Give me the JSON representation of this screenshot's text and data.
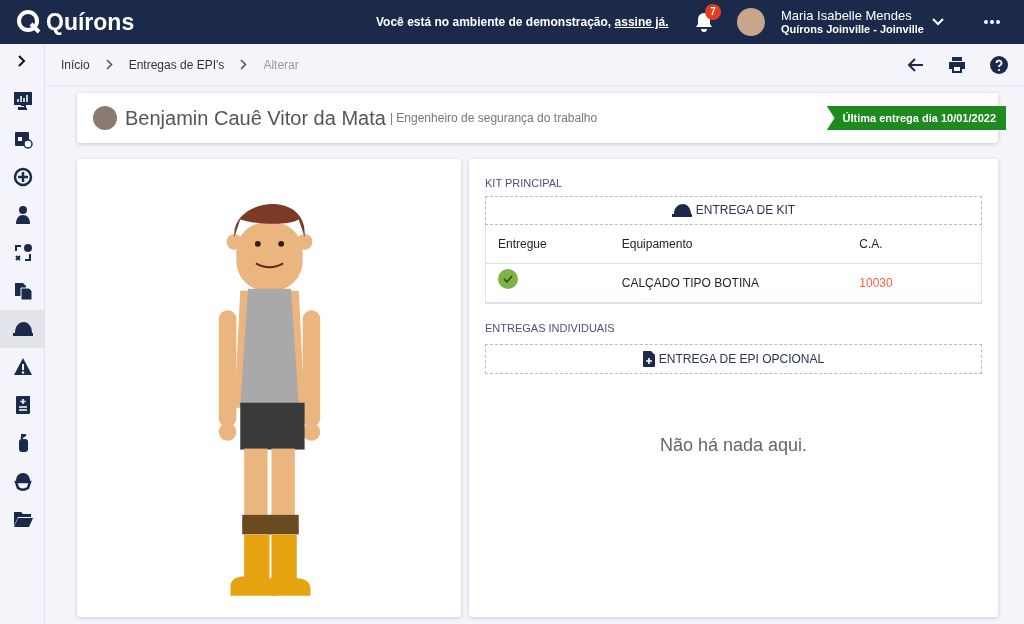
{
  "topbar": {
    "logo": "Quírons",
    "notice": "Você está no ambiente de demonstração,",
    "notice_link": "assine já.",
    "notifications": "7",
    "user_name": "Maria Isabelle Mendes",
    "user_company": "Quírons Joinville - Joinville"
  },
  "sidebar": {
    "items": [
      {
        "selected": false
      },
      {
        "selected": false
      },
      {
        "selected": false
      },
      {
        "selected": false
      },
      {
        "selected": false
      },
      {
        "selected": false
      },
      {
        "selected": true
      },
      {
        "selected": false
      },
      {
        "selected": false
      },
      {
        "selected": false
      },
      {
        "selected": false
      },
      {
        "selected": false
      }
    ]
  },
  "breadcrumb": [
    {
      "label": "Início",
      "current": false
    },
    {
      "label": "Entregas de EPI's",
      "current": false
    },
    {
      "label": "Alterar",
      "current": true
    }
  ],
  "employee": {
    "name": "Benjamin Cauê Vitor da Mata",
    "role": "| Engenheiro de segurança do trabalho",
    "last_delivery": "Última entrega dia 10/01/2022"
  },
  "kit": {
    "title": "KIT PRINCIPAL",
    "button": "ENTREGA DE KIT",
    "columns": [
      "Entregue",
      "Equipamento",
      "C.A."
    ],
    "rows": [
      {
        "delivered": true,
        "equipment": "CALÇADO TIPO BOTINA",
        "ca": "10030"
      }
    ]
  },
  "individual": {
    "title": "ENTREGAS INDIVIDUAIS",
    "button": "ENTREGA DE EPI OPCIONAL",
    "empty": "Não há nada aqui."
  }
}
